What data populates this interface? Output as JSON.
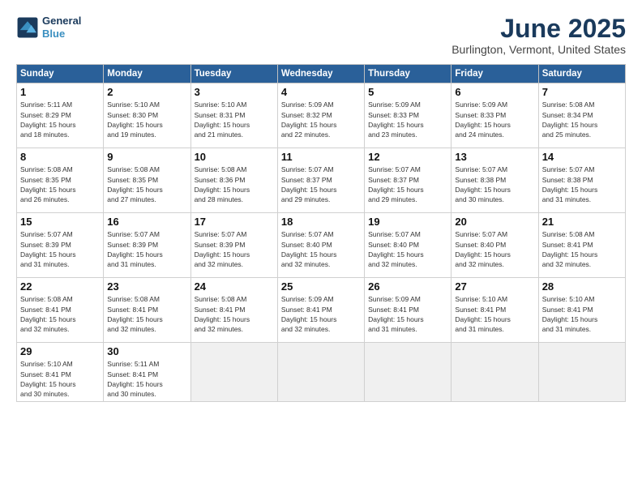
{
  "header": {
    "logo_line1": "General",
    "logo_line2": "Blue",
    "title": "June 2025",
    "subtitle": "Burlington, Vermont, United States"
  },
  "weekdays": [
    "Sunday",
    "Monday",
    "Tuesday",
    "Wednesday",
    "Thursday",
    "Friday",
    "Saturday"
  ],
  "weeks": [
    [
      {
        "day": "1",
        "text": "Sunrise: 5:11 AM\nSunset: 8:29 PM\nDaylight: 15 hours\nand 18 minutes."
      },
      {
        "day": "2",
        "text": "Sunrise: 5:10 AM\nSunset: 8:30 PM\nDaylight: 15 hours\nand 19 minutes."
      },
      {
        "day": "3",
        "text": "Sunrise: 5:10 AM\nSunset: 8:31 PM\nDaylight: 15 hours\nand 21 minutes."
      },
      {
        "day": "4",
        "text": "Sunrise: 5:09 AM\nSunset: 8:32 PM\nDaylight: 15 hours\nand 22 minutes."
      },
      {
        "day": "5",
        "text": "Sunrise: 5:09 AM\nSunset: 8:33 PM\nDaylight: 15 hours\nand 23 minutes."
      },
      {
        "day": "6",
        "text": "Sunrise: 5:09 AM\nSunset: 8:33 PM\nDaylight: 15 hours\nand 24 minutes."
      },
      {
        "day": "7",
        "text": "Sunrise: 5:08 AM\nSunset: 8:34 PM\nDaylight: 15 hours\nand 25 minutes."
      }
    ],
    [
      {
        "day": "8",
        "text": "Sunrise: 5:08 AM\nSunset: 8:35 PM\nDaylight: 15 hours\nand 26 minutes."
      },
      {
        "day": "9",
        "text": "Sunrise: 5:08 AM\nSunset: 8:35 PM\nDaylight: 15 hours\nand 27 minutes."
      },
      {
        "day": "10",
        "text": "Sunrise: 5:08 AM\nSunset: 8:36 PM\nDaylight: 15 hours\nand 28 minutes."
      },
      {
        "day": "11",
        "text": "Sunrise: 5:07 AM\nSunset: 8:37 PM\nDaylight: 15 hours\nand 29 minutes."
      },
      {
        "day": "12",
        "text": "Sunrise: 5:07 AM\nSunset: 8:37 PM\nDaylight: 15 hours\nand 29 minutes."
      },
      {
        "day": "13",
        "text": "Sunrise: 5:07 AM\nSunset: 8:38 PM\nDaylight: 15 hours\nand 30 minutes."
      },
      {
        "day": "14",
        "text": "Sunrise: 5:07 AM\nSunset: 8:38 PM\nDaylight: 15 hours\nand 31 minutes."
      }
    ],
    [
      {
        "day": "15",
        "text": "Sunrise: 5:07 AM\nSunset: 8:39 PM\nDaylight: 15 hours\nand 31 minutes."
      },
      {
        "day": "16",
        "text": "Sunrise: 5:07 AM\nSunset: 8:39 PM\nDaylight: 15 hours\nand 31 minutes."
      },
      {
        "day": "17",
        "text": "Sunrise: 5:07 AM\nSunset: 8:39 PM\nDaylight: 15 hours\nand 32 minutes."
      },
      {
        "day": "18",
        "text": "Sunrise: 5:07 AM\nSunset: 8:40 PM\nDaylight: 15 hours\nand 32 minutes."
      },
      {
        "day": "19",
        "text": "Sunrise: 5:07 AM\nSunset: 8:40 PM\nDaylight: 15 hours\nand 32 minutes."
      },
      {
        "day": "20",
        "text": "Sunrise: 5:07 AM\nSunset: 8:40 PM\nDaylight: 15 hours\nand 32 minutes."
      },
      {
        "day": "21",
        "text": "Sunrise: 5:08 AM\nSunset: 8:41 PM\nDaylight: 15 hours\nand 32 minutes."
      }
    ],
    [
      {
        "day": "22",
        "text": "Sunrise: 5:08 AM\nSunset: 8:41 PM\nDaylight: 15 hours\nand 32 minutes."
      },
      {
        "day": "23",
        "text": "Sunrise: 5:08 AM\nSunset: 8:41 PM\nDaylight: 15 hours\nand 32 minutes."
      },
      {
        "day": "24",
        "text": "Sunrise: 5:08 AM\nSunset: 8:41 PM\nDaylight: 15 hours\nand 32 minutes."
      },
      {
        "day": "25",
        "text": "Sunrise: 5:09 AM\nSunset: 8:41 PM\nDaylight: 15 hours\nand 32 minutes."
      },
      {
        "day": "26",
        "text": "Sunrise: 5:09 AM\nSunset: 8:41 PM\nDaylight: 15 hours\nand 31 minutes."
      },
      {
        "day": "27",
        "text": "Sunrise: 5:10 AM\nSunset: 8:41 PM\nDaylight: 15 hours\nand 31 minutes."
      },
      {
        "day": "28",
        "text": "Sunrise: 5:10 AM\nSunset: 8:41 PM\nDaylight: 15 hours\nand 31 minutes."
      }
    ],
    [
      {
        "day": "29",
        "text": "Sunrise: 5:10 AM\nSunset: 8:41 PM\nDaylight: 15 hours\nand 30 minutes."
      },
      {
        "day": "30",
        "text": "Sunrise: 5:11 AM\nSunset: 8:41 PM\nDaylight: 15 hours\nand 30 minutes."
      },
      {
        "day": "",
        "text": ""
      },
      {
        "day": "",
        "text": ""
      },
      {
        "day": "",
        "text": ""
      },
      {
        "day": "",
        "text": ""
      },
      {
        "day": "",
        "text": ""
      }
    ]
  ]
}
